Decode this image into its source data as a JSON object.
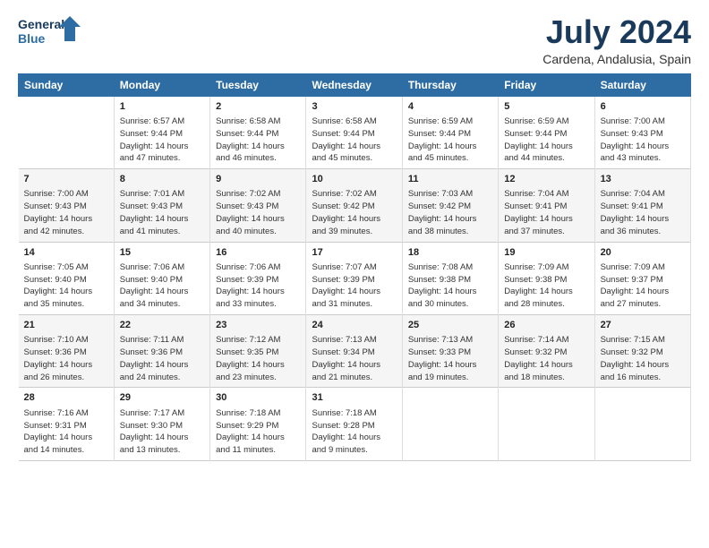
{
  "header": {
    "logo_line1": "General",
    "logo_line2": "Blue",
    "title": "July 2024",
    "subtitle": "Cardena, Andalusia, Spain"
  },
  "columns": [
    "Sunday",
    "Monday",
    "Tuesday",
    "Wednesday",
    "Thursday",
    "Friday",
    "Saturday"
  ],
  "rows": [
    [
      {
        "day": "",
        "content": ""
      },
      {
        "day": "1",
        "content": "Sunrise: 6:57 AM\nSunset: 9:44 PM\nDaylight: 14 hours\nand 47 minutes."
      },
      {
        "day": "2",
        "content": "Sunrise: 6:58 AM\nSunset: 9:44 PM\nDaylight: 14 hours\nand 46 minutes."
      },
      {
        "day": "3",
        "content": "Sunrise: 6:58 AM\nSunset: 9:44 PM\nDaylight: 14 hours\nand 45 minutes."
      },
      {
        "day": "4",
        "content": "Sunrise: 6:59 AM\nSunset: 9:44 PM\nDaylight: 14 hours\nand 45 minutes."
      },
      {
        "day": "5",
        "content": "Sunrise: 6:59 AM\nSunset: 9:44 PM\nDaylight: 14 hours\nand 44 minutes."
      },
      {
        "day": "6",
        "content": "Sunrise: 7:00 AM\nSunset: 9:43 PM\nDaylight: 14 hours\nand 43 minutes."
      }
    ],
    [
      {
        "day": "7",
        "content": "Sunrise: 7:00 AM\nSunset: 9:43 PM\nDaylight: 14 hours\nand 42 minutes."
      },
      {
        "day": "8",
        "content": "Sunrise: 7:01 AM\nSunset: 9:43 PM\nDaylight: 14 hours\nand 41 minutes."
      },
      {
        "day": "9",
        "content": "Sunrise: 7:02 AM\nSunset: 9:43 PM\nDaylight: 14 hours\nand 40 minutes."
      },
      {
        "day": "10",
        "content": "Sunrise: 7:02 AM\nSunset: 9:42 PM\nDaylight: 14 hours\nand 39 minutes."
      },
      {
        "day": "11",
        "content": "Sunrise: 7:03 AM\nSunset: 9:42 PM\nDaylight: 14 hours\nand 38 minutes."
      },
      {
        "day": "12",
        "content": "Sunrise: 7:04 AM\nSunset: 9:41 PM\nDaylight: 14 hours\nand 37 minutes."
      },
      {
        "day": "13",
        "content": "Sunrise: 7:04 AM\nSunset: 9:41 PM\nDaylight: 14 hours\nand 36 minutes."
      }
    ],
    [
      {
        "day": "14",
        "content": "Sunrise: 7:05 AM\nSunset: 9:40 PM\nDaylight: 14 hours\nand 35 minutes."
      },
      {
        "day": "15",
        "content": "Sunrise: 7:06 AM\nSunset: 9:40 PM\nDaylight: 14 hours\nand 34 minutes."
      },
      {
        "day": "16",
        "content": "Sunrise: 7:06 AM\nSunset: 9:39 PM\nDaylight: 14 hours\nand 33 minutes."
      },
      {
        "day": "17",
        "content": "Sunrise: 7:07 AM\nSunset: 9:39 PM\nDaylight: 14 hours\nand 31 minutes."
      },
      {
        "day": "18",
        "content": "Sunrise: 7:08 AM\nSunset: 9:38 PM\nDaylight: 14 hours\nand 30 minutes."
      },
      {
        "day": "19",
        "content": "Sunrise: 7:09 AM\nSunset: 9:38 PM\nDaylight: 14 hours\nand 28 minutes."
      },
      {
        "day": "20",
        "content": "Sunrise: 7:09 AM\nSunset: 9:37 PM\nDaylight: 14 hours\nand 27 minutes."
      }
    ],
    [
      {
        "day": "21",
        "content": "Sunrise: 7:10 AM\nSunset: 9:36 PM\nDaylight: 14 hours\nand 26 minutes."
      },
      {
        "day": "22",
        "content": "Sunrise: 7:11 AM\nSunset: 9:36 PM\nDaylight: 14 hours\nand 24 minutes."
      },
      {
        "day": "23",
        "content": "Sunrise: 7:12 AM\nSunset: 9:35 PM\nDaylight: 14 hours\nand 23 minutes."
      },
      {
        "day": "24",
        "content": "Sunrise: 7:13 AM\nSunset: 9:34 PM\nDaylight: 14 hours\nand 21 minutes."
      },
      {
        "day": "25",
        "content": "Sunrise: 7:13 AM\nSunset: 9:33 PM\nDaylight: 14 hours\nand 19 minutes."
      },
      {
        "day": "26",
        "content": "Sunrise: 7:14 AM\nSunset: 9:32 PM\nDaylight: 14 hours\nand 18 minutes."
      },
      {
        "day": "27",
        "content": "Sunrise: 7:15 AM\nSunset: 9:32 PM\nDaylight: 14 hours\nand 16 minutes."
      }
    ],
    [
      {
        "day": "28",
        "content": "Sunrise: 7:16 AM\nSunset: 9:31 PM\nDaylight: 14 hours\nand 14 minutes."
      },
      {
        "day": "29",
        "content": "Sunrise: 7:17 AM\nSunset: 9:30 PM\nDaylight: 14 hours\nand 13 minutes."
      },
      {
        "day": "30",
        "content": "Sunrise: 7:18 AM\nSunset: 9:29 PM\nDaylight: 14 hours\nand 11 minutes."
      },
      {
        "day": "31",
        "content": "Sunrise: 7:18 AM\nSunset: 9:28 PM\nDaylight: 14 hours\nand 9 minutes."
      },
      {
        "day": "",
        "content": ""
      },
      {
        "day": "",
        "content": ""
      },
      {
        "day": "",
        "content": ""
      }
    ]
  ]
}
